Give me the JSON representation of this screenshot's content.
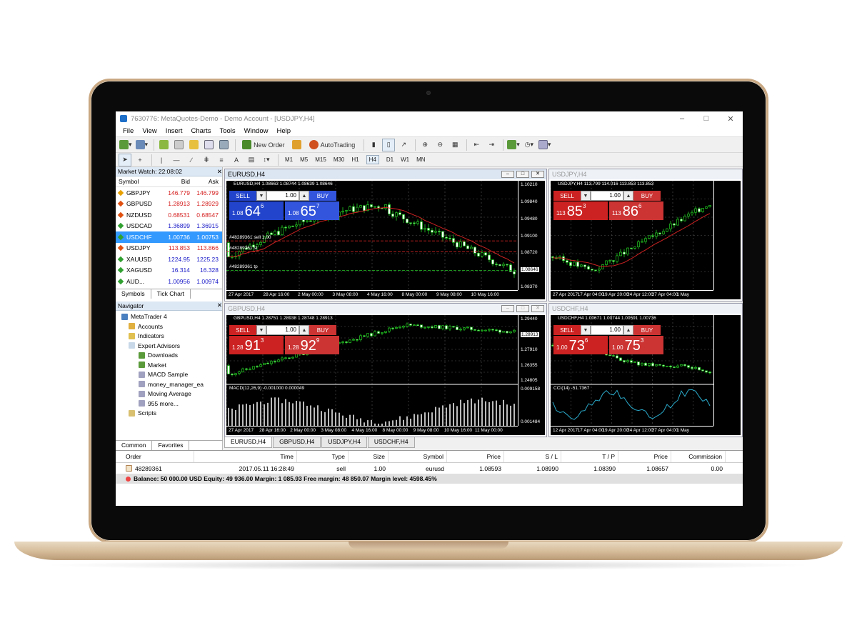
{
  "window": {
    "title": "7630776: MetaQuotes-Demo - Demo Account - [USDJPY,H4]"
  },
  "menu": [
    "File",
    "View",
    "Insert",
    "Charts",
    "Tools",
    "Window",
    "Help"
  ],
  "toolbar": {
    "new_order": "New Order",
    "auto_trading": "AutoTrading"
  },
  "toolbar2": {
    "text_tool": "A",
    "timeframes": [
      "M1",
      "M5",
      "M15",
      "M30",
      "H1",
      "H4",
      "D1",
      "W1",
      "MN"
    ],
    "active_tf": "H4"
  },
  "market_watch": {
    "title": "Market Watch: 22:08:02",
    "headers": [
      "Symbol",
      "Bid",
      "Ask"
    ],
    "rows": [
      {
        "s": "GBPJPY",
        "b": "146.779",
        "a": "146.799",
        "c": "#e8a000"
      },
      {
        "s": "GBPUSD",
        "b": "1.28913",
        "a": "1.28929",
        "c": "#e05010"
      },
      {
        "s": "NZDUSD",
        "b": "0.68531",
        "a": "0.68547",
        "c": "#e05010"
      },
      {
        "s": "USDCAD",
        "b": "1.36899",
        "a": "1.36915",
        "c": "#30a030"
      },
      {
        "s": "USDCHF",
        "b": "1.00736",
        "a": "1.00753",
        "c": "#30a030"
      },
      {
        "s": "USDJPY",
        "b": "113.853",
        "a": "113.866",
        "c": "#e05010"
      },
      {
        "s": "XAUUSD",
        "b": "1224.95",
        "a": "1225.23",
        "c": "#30a030"
      },
      {
        "s": "XAGUSD",
        "b": "16.314",
        "a": "16.328",
        "c": "#30a030"
      },
      {
        "s": "AUD...",
        "b": "1.00956",
        "a": "1.00974",
        "c": "#30a030"
      }
    ],
    "tabs": [
      "Symbols",
      "Tick Chart"
    ]
  },
  "navigator": {
    "title": "Navigator",
    "items": [
      "MetaTrader 4",
      "Accounts",
      "Indicators",
      "Expert Advisors",
      "Downloads",
      "Market",
      "MACD Sample",
      "money_manager_ea",
      "Moving Average",
      "955 more...",
      "Scripts"
    ],
    "tabs": [
      "Common",
      "Favorites"
    ]
  },
  "charts": [
    {
      "title": "EURUSD,H4",
      "sym": "EURUSD,H4  1.08663 1.08744 1.08639 1.08646",
      "lot": "1.00",
      "sell": {
        "s": "1.08",
        "b": "64",
        "sup": "6"
      },
      "buy": {
        "s": "1.08",
        "b": "65",
        "sup": "7"
      },
      "prices": [
        "1.10210",
        "1.09840",
        "1.09480",
        "1.09100",
        "1.08720",
        "1.08646",
        "1.08370"
      ],
      "dates": [
        "27 Apr 2017",
        "28 Apr 16:00",
        "2 May 00:00",
        "3 May 08:00",
        "4 May 16:00",
        "8 May 00:00",
        "9 May 08:00",
        "10 May 16:00"
      ],
      "order1": "#48289361 sell 1.00",
      "order2": "#48289361 tp",
      "order3": "#48289361 sl"
    },
    {
      "title": "USDJPY,H4",
      "sym": "USDJPY,H4  113.799 114.016 113.853 113.853",
      "lot": "1.00",
      "sell": {
        "s": "113",
        "b": "85",
        "sup": "3"
      },
      "buy": {
        "s": "113",
        "b": "86",
        "sup": "6"
      },
      "dates": [
        "27 Apr 2017",
        "17 Apr 04:00",
        "19 Apr 20:00",
        "24 Apr 12:00",
        "27 Apr 04:00",
        "1 May"
      ]
    },
    {
      "title": "GBPUSD,H4",
      "sym": "GBPUSD,H4  1.28751 1.28938 1.28748 1.28913",
      "lot": "1.00",
      "sell": {
        "s": "1.28",
        "b": "91",
        "sup": "3"
      },
      "buy": {
        "s": "1.28",
        "b": "92",
        "sup": "9"
      },
      "prices": [
        "1.29440",
        "1.28913",
        "1.27910",
        "1.26355",
        "1.24805",
        "0.009158",
        "0.001484"
      ],
      "macd": "MACD(12,26,9) -0.001000 0.000049",
      "dates": [
        "27 Apr 2017",
        "28 Apr 16:00",
        "2 May 00:00",
        "3 May 08:00",
        "4 May 16:00",
        "8 May 00:00",
        "9 May 08:00",
        "10 May 16:00",
        "11 May 00:00"
      ]
    },
    {
      "title": "USDCHF,H4",
      "sym": "USDCHF,H4  1.00671 1.00744 1.00591 1.00736",
      "lot": "1.00",
      "sell": {
        "s": "1.00",
        "b": "73",
        "sup": "6"
      },
      "buy": {
        "s": "1.00",
        "b": "75",
        "sup": "3"
      },
      "cci": "CCI(14) -51.7367",
      "dates": [
        "12 Apr 2017",
        "17 Apr 04:00",
        "19 Apr 20:00",
        "24 Apr 12:00",
        "27 Apr 04:00",
        "1 May"
      ]
    }
  ],
  "trade_labels": {
    "sell": "SELL",
    "buy": "BUY",
    "up": "▲",
    "down": "▼"
  },
  "chart_tabs": [
    "EURUSD,H4",
    "GBPUSD,H4",
    "USDJPY,H4",
    "USDCHF,H4"
  ],
  "terminal": {
    "headers": [
      "Order",
      "Time",
      "Type",
      "Size",
      "Symbol",
      "Price",
      "S / L",
      "T / P",
      "Price",
      "Commission"
    ],
    "row": [
      "48289361",
      "2017.05.11 16:28:49",
      "sell",
      "1.00",
      "eurusd",
      "1.08593",
      "1.08990",
      "1.08390",
      "1.08657",
      "0.00"
    ],
    "balance": "Balance: 50 000.00 USD  Equity: 49 936.00  Margin: 1 085.93  Free margin: 48 850.07  Margin level: 4598.45%"
  },
  "colors": {
    "sell_blue": "#2244cc",
    "buy_blue": "#3355dd",
    "sell_red": "#cc2222",
    "buy_red": "#cc3333",
    "candle": "#22cc22",
    "ma": "#cc2222"
  }
}
